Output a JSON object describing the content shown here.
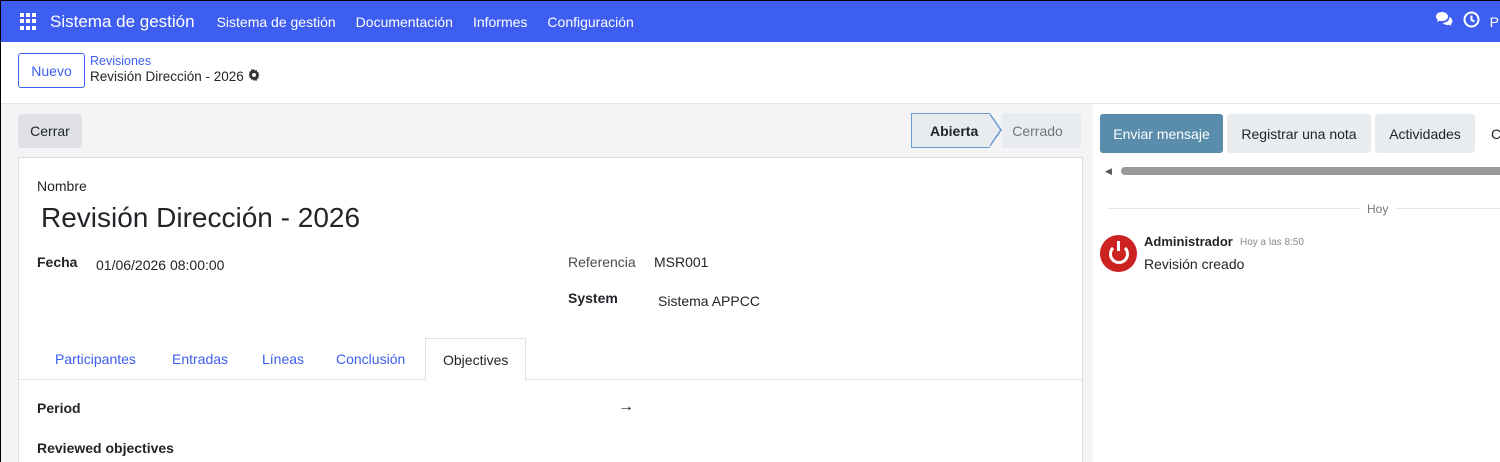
{
  "navbar": {
    "app_name": "Sistema de gestión",
    "menu": [
      "Sistema de gestión",
      "Documentación",
      "Informes",
      "Configuración"
    ],
    "user_initial": "P",
    "icons": [
      "apps-grid-icon",
      "chat-icon",
      "clock-icon"
    ]
  },
  "control_panel": {
    "new_label": "Nuevo",
    "breadcrumb_parent": "Revisiones",
    "breadcrumb_current": "Revisión Dirección - 2026"
  },
  "form": {
    "close_label": "Cerrar",
    "status": {
      "active": "Abierta",
      "inactive": "Cerrado"
    },
    "name_label": "Nombre",
    "title": "Revisión Dirección - 2026",
    "fecha_label": "Fecha",
    "fecha_value": "01/06/2026 08:00:00",
    "referencia_label": "Referencia",
    "referencia_value": "MSR001",
    "system_label": "System",
    "system_value": "Sistema APPCC",
    "tabs": [
      "Participantes",
      "Entradas",
      "Líneas",
      "Conclusión",
      "Objectives"
    ],
    "active_tab": "Objectives",
    "period_label": "Period",
    "period_arrow": "→",
    "reviewed_label": "Reviewed objectives"
  },
  "chatter": {
    "send_label": "Enviar mensaje",
    "note_label": "Registrar una nota",
    "activities_label": "Actividades",
    "more_label": "C",
    "date_separator": "Hoy",
    "messages": [
      {
        "author": "Administrador",
        "time": "Hoy a las 8:50",
        "body": "Revisión creado"
      }
    ]
  },
  "colors": {
    "navbar": "#3d5ef0",
    "send_button": "#5a8dab",
    "avatar": "#cc2222"
  }
}
